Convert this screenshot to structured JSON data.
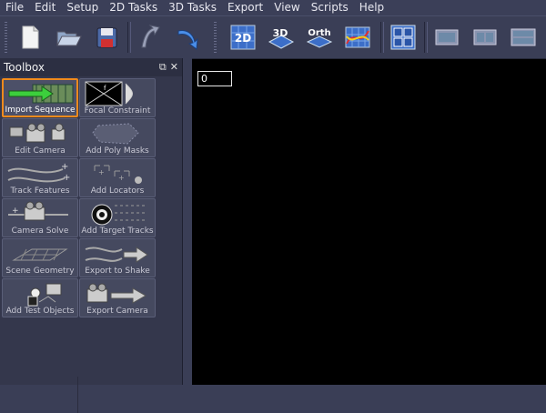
{
  "menu": [
    "File",
    "Edit",
    "Setup",
    "2D Tasks",
    "3D Tasks",
    "Export",
    "View",
    "Scripts",
    "Help"
  ],
  "toolbar": {
    "labels_2d": "2D",
    "labels_3d": "3D",
    "labels_orth": "Orth"
  },
  "toolbox": {
    "title": "Toolbox",
    "tools": [
      {
        "label": "Import Sequence",
        "icon": "filmstrip-arrow-icon",
        "selected": true
      },
      {
        "label": "Focal Constraint",
        "icon": "focal-frame-icon",
        "selected": false
      },
      {
        "label": "Edit Camera",
        "icon": "camera-icon",
        "selected": false
      },
      {
        "label": "Add Poly Masks",
        "icon": "poly-mask-icon",
        "selected": false
      },
      {
        "label": "Track Features",
        "icon": "track-paths-icon",
        "selected": false
      },
      {
        "label": "Add Locators",
        "icon": "locator-icon",
        "selected": false
      },
      {
        "label": "Camera Solve",
        "icon": "camera-solve-icon",
        "selected": false
      },
      {
        "label": "Add Target Tracks",
        "icon": "target-icon",
        "selected": false
      },
      {
        "label": "Scene Geometry",
        "icon": "geometry-grid-icon",
        "selected": false
      },
      {
        "label": "Export to Shake",
        "icon": "export-paths-icon",
        "selected": false
      },
      {
        "label": "Add Test Objects",
        "icon": "test-objects-icon",
        "selected": false
      },
      {
        "label": "Export Camera",
        "icon": "export-camera-icon",
        "selected": false
      }
    ]
  },
  "viewport": {
    "frame_number": "0"
  },
  "colors": {
    "accent": "#f08a1c",
    "viewport_bg": "#000000",
    "panel_bg": "#3a3e56"
  }
}
